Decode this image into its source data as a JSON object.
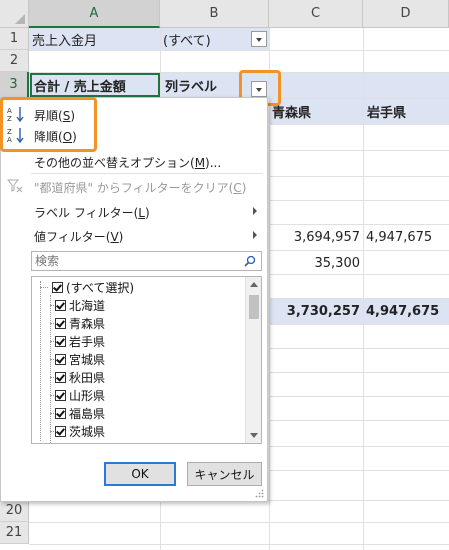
{
  "columns": [
    "A",
    "B",
    "C",
    "D"
  ],
  "rows": [
    "1",
    "2",
    "3",
    "20",
    "21"
  ],
  "cells": {
    "a1": "売上入金月",
    "b1": "(すべて)",
    "a3": "合計 / 売上金額",
    "b3": "列ラベル",
    "c4": "青森県",
    "d4": "岩手県",
    "c7": "3,694,957",
    "d7": "4,947,675",
    "c8": "35,300",
    "c10": "3,730,257",
    "d10": "4,947,675"
  },
  "menu": {
    "sort_asc": "昇順(S)",
    "sort_asc_pre": "昇順(",
    "sort_asc_key": "S",
    "sort_desc_pre": "降順(",
    "sort_desc_key": "O",
    "more_sort_pre": "その他の並べ替えオプション(",
    "more_sort_key": "M",
    "more_sort_post": ")...",
    "clear_filter_pre": "\"都道府県\" からフィルターをクリア(",
    "clear_filter_key": "C",
    "label_filter_pre": "ラベル フィルター(",
    "label_filter_key": "L",
    "value_filter_pre": "値フィルター(",
    "value_filter_key": "V",
    "close_paren": ")",
    "search_placeholder": "検索",
    "list_items": [
      "(すべて選択)",
      "北海道",
      "青森県",
      "岩手県",
      "宮城県",
      "秋田県",
      "山形県",
      "福島県",
      "茨城県"
    ],
    "ok": "OK",
    "cancel": "キャンセル"
  },
  "colors": {
    "highlight": "#f29325",
    "pivot_band": "#dce3f2",
    "excel_green": "#217346"
  }
}
